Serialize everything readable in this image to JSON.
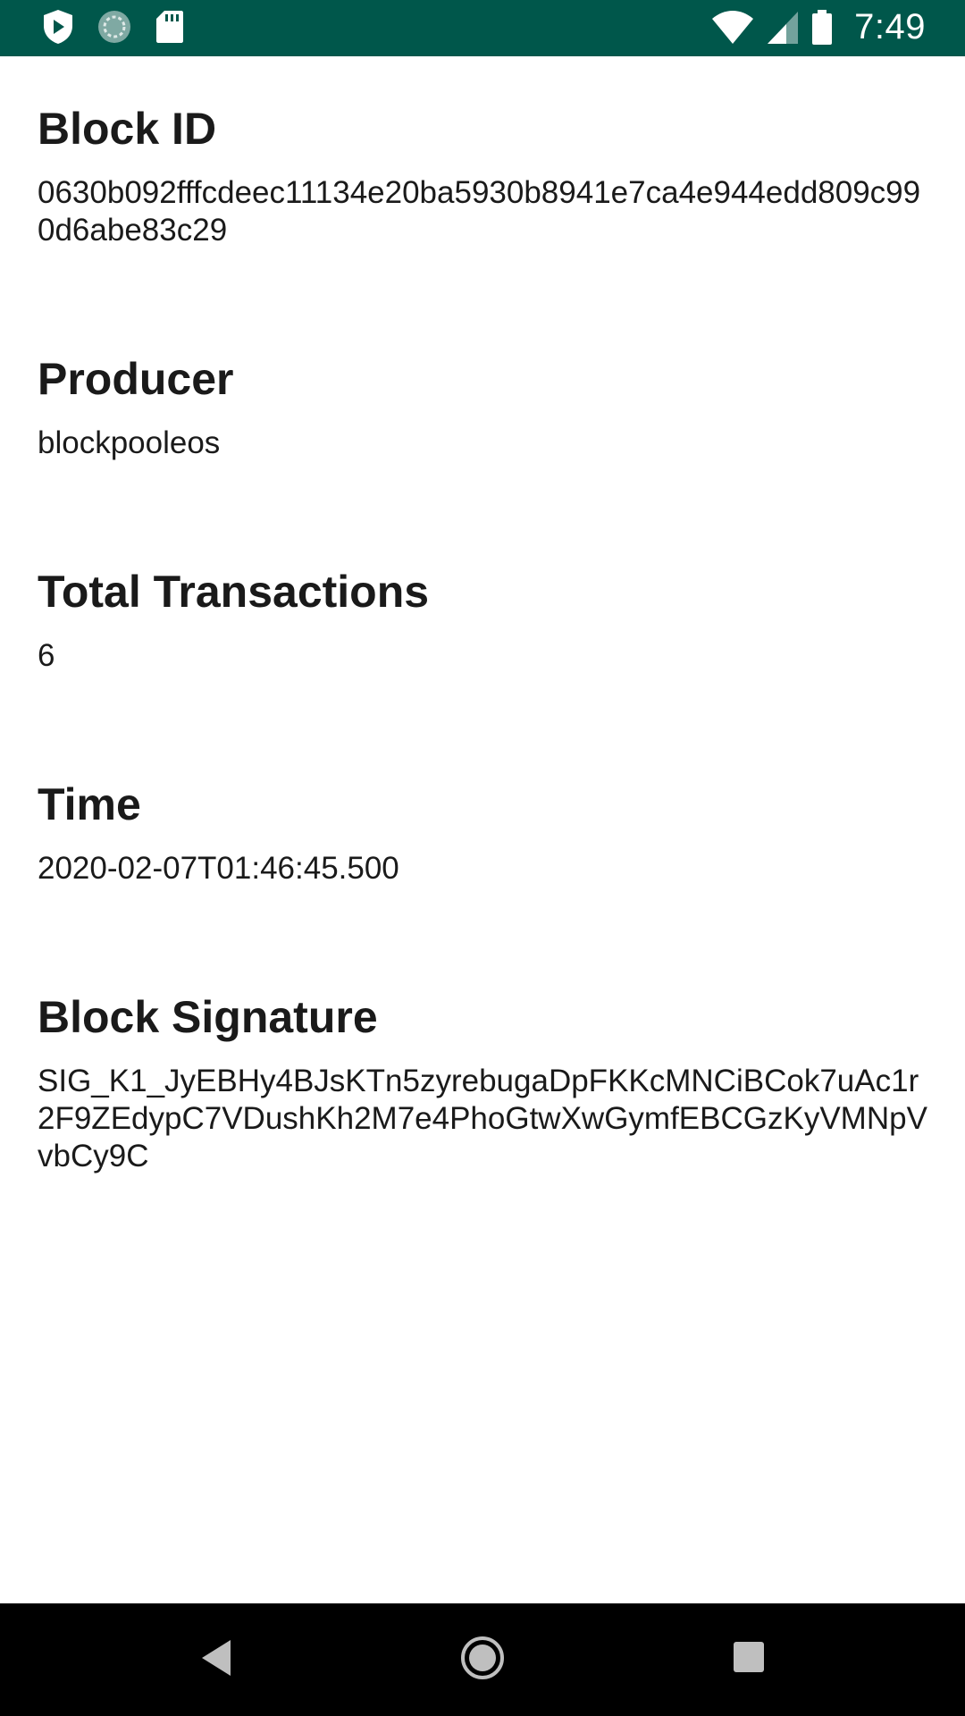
{
  "status_bar": {
    "icons_left": [
      "play-protect-icon",
      "sync-icon",
      "sd-card-icon"
    ],
    "icons_right": [
      "wifi-icon",
      "signal-icon",
      "battery-icon"
    ],
    "time": "7:49",
    "color": "#00574b"
  },
  "block": {
    "sections": [
      {
        "title": "Block ID",
        "value": "0630b092fffcdeec11134e20ba5930b8941e7ca4e944edd809c990d6abe83c29"
      },
      {
        "title": "Producer",
        "value": "blockpooleos"
      },
      {
        "title": "Total Transactions",
        "value": "6"
      },
      {
        "title": "Time",
        "value": "2020-02-07T01:46:45.500"
      },
      {
        "title": "Block Signature",
        "value": "SIG_K1_JyEBHy4BJsKTn5zyrebugaDpFKKcMNCiBCok7uAc1r2F9ZEdypC7VDushKh2M7e4PhoGtwXwGymfEBCGzKyVMNpVvbCy9C"
      }
    ]
  },
  "nav_bar": {
    "buttons": [
      "back-icon",
      "home-icon",
      "recents-icon"
    ]
  }
}
